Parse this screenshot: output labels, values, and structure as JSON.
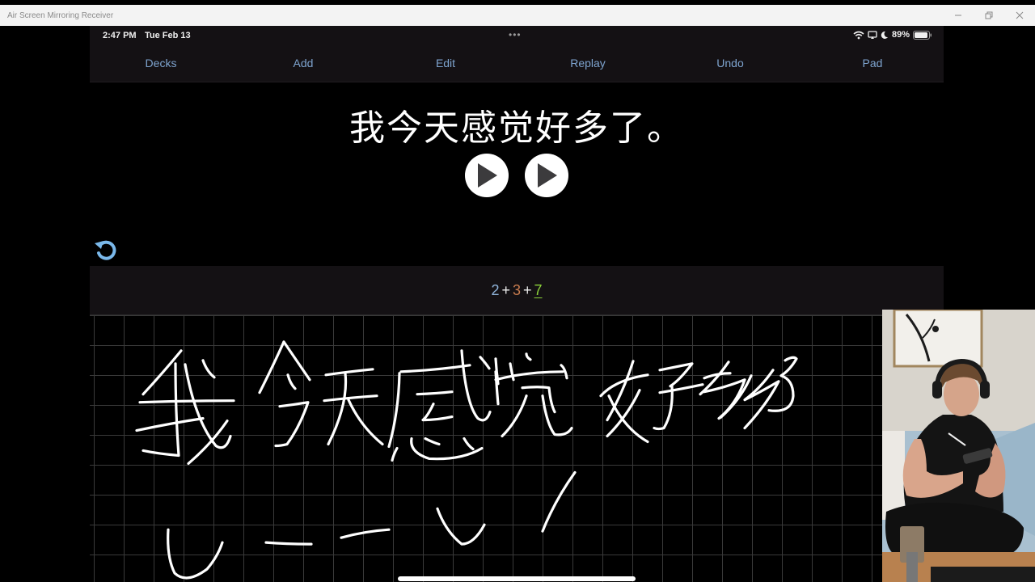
{
  "window": {
    "title": "Air Screen Mirroring Receiver",
    "controls": [
      "minimize",
      "restore",
      "close"
    ]
  },
  "statusbar": {
    "time": "2:47 PM",
    "date": "Tue Feb 13",
    "battery": "89%",
    "icons": [
      "wifi-icon",
      "screen-mirroring-icon",
      "moon-icon",
      "battery-icon"
    ]
  },
  "toolbar": {
    "items": [
      {
        "label": "Decks"
      },
      {
        "label": "Add"
      },
      {
        "label": "Edit"
      },
      {
        "label": "Replay"
      },
      {
        "label": "Undo"
      },
      {
        "label": "Pad"
      }
    ]
  },
  "card": {
    "sentence": "我今天感觉好多了。",
    "play_buttons": [
      "play-audio-normal",
      "play-audio-slow"
    ]
  },
  "formula": {
    "parts": [
      "2",
      "+",
      "3",
      "+",
      "7"
    ],
    "colors": {
      "again": "#8fb3d9",
      "hard": "#c77b4e",
      "good": "#8bd13a"
    }
  },
  "pad": {
    "handwritten_text": "我今天感觉好多了",
    "tone_marks": "˘ ¯ ¯ ˘ ´"
  },
  "webcam": {
    "description": "Person with headphones writing on a phone with a stylus"
  }
}
